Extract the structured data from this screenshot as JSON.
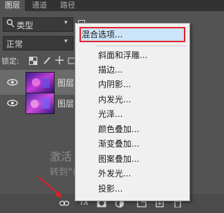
{
  "tabs": [
    {
      "label": "图层",
      "active": true
    },
    {
      "label": "通道",
      "active": false
    },
    {
      "label": "路径",
      "active": false
    }
  ],
  "filter": {
    "label": "类型"
  },
  "blend_mode": {
    "value": "正常"
  },
  "lock": {
    "label": "锁定:"
  },
  "layers": [
    {
      "name": "图层",
      "selected": true
    },
    {
      "name": "图层",
      "selected": false
    }
  ],
  "context_menu": {
    "highlighted": "混合选项...",
    "items": [
      "斜面和浮雕...",
      "描边...",
      "内阴影...",
      "内发光...",
      "光泽...",
      "颜色叠加...",
      "渐变叠加...",
      "图案叠加...",
      "外发光...",
      "投影..."
    ]
  },
  "watermark": {
    "line1": "激活 Windows",
    "line2": "转到“设置”以激活 Windows。"
  },
  "colors": {
    "highlight_outline": "#e0202a",
    "arrow": "#e0202a",
    "menu_bg": "#f0f0f0"
  }
}
